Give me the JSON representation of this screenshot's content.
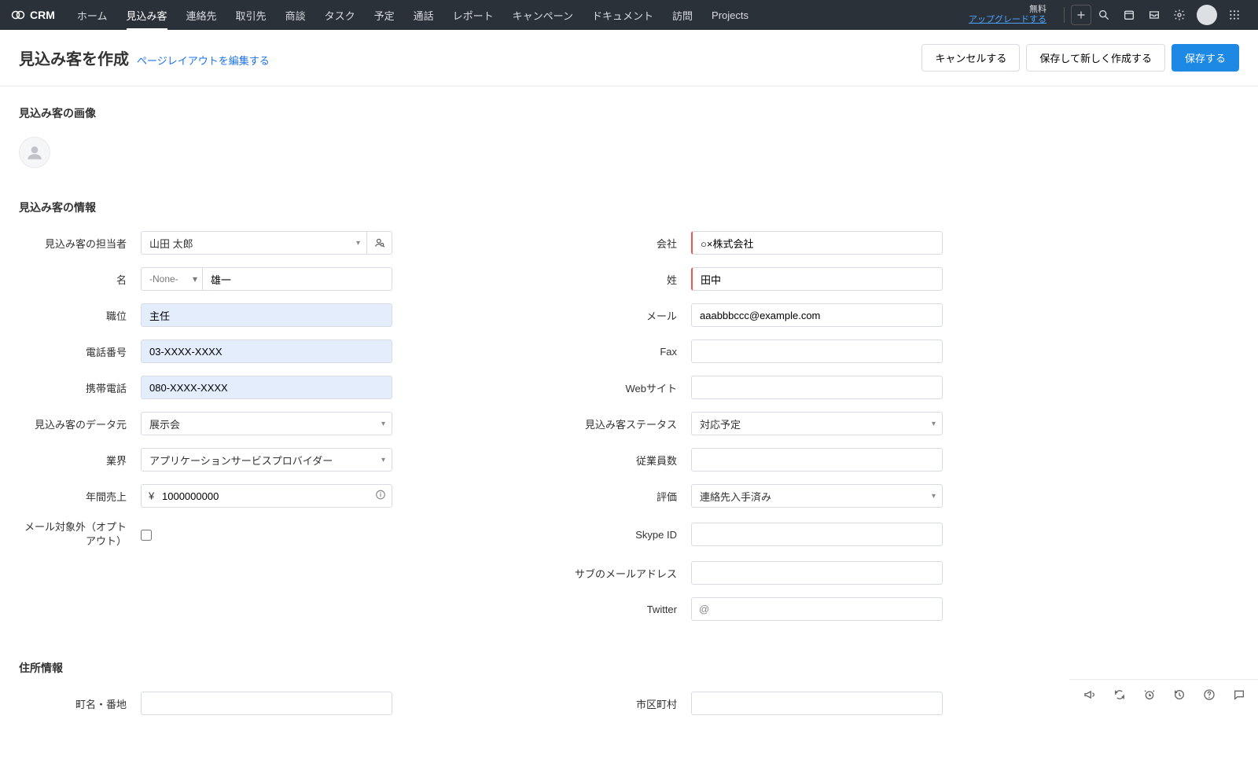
{
  "nav": {
    "brand": "CRM",
    "items": [
      "ホーム",
      "見込み客",
      "連絡先",
      "取引先",
      "商談",
      "タスク",
      "予定",
      "通話",
      "レポート",
      "キャンペーン",
      "ドキュメント",
      "訪問",
      "Projects"
    ],
    "active_index": 1,
    "upgrade_free": "無料",
    "upgrade_link": "アップグレードする"
  },
  "header": {
    "title": "見込み客を作成",
    "edit_layout": "ページレイアウトを編集する",
    "cancel": "キャンセルする",
    "save_new": "保存して新しく作成する",
    "save": "保存する"
  },
  "sec_image": {
    "title": "見込み客の画像"
  },
  "sec_info": {
    "title": "見込み客の情報",
    "owner_label": "見込み客の担当者",
    "owner_value": "山田 太郎",
    "company_label": "会社",
    "company_value": "○×株式会社",
    "firstname_label": "名",
    "salutation": "-None-",
    "firstname_value": "雄一",
    "lastname_label": "姓",
    "lastname_value": "田中",
    "jobtitle_label": "職位",
    "jobtitle_value": "主任",
    "email_label": "メール",
    "email_value": "aaabbbccc@example.com",
    "phone_label": "電話番号",
    "phone_value": "03-XXXX-XXXX",
    "fax_label": "Fax",
    "fax_value": "",
    "mobile_label": "携帯電話",
    "mobile_value": "080-XXXX-XXXX",
    "website_label": "Webサイト",
    "website_value": "",
    "source_label": "見込み客のデータ元",
    "source_value": "展示会",
    "status_label": "見込み客ステータス",
    "status_value": "対応予定",
    "industry_label": "業界",
    "industry_value": "アプリケーションサービスプロバイダー",
    "employees_label": "従業員数",
    "employees_value": "",
    "revenue_label": "年間売上",
    "revenue_value": "1000000000",
    "revenue_currency": "¥",
    "rating_label": "評価",
    "rating_value": "連絡先入手済み",
    "optout_label": "メール対象外（オプトアウト）",
    "skype_label": "Skype ID",
    "skype_value": "",
    "subemail_label": "サブのメールアドレス",
    "subemail_value": "",
    "twitter_label": "Twitter",
    "twitter_value": "",
    "twitter_at": "@"
  },
  "sec_address": {
    "title": "住所情報",
    "street_label": "町名・番地",
    "street_value": "",
    "city_label": "市区町村",
    "city_value": ""
  }
}
